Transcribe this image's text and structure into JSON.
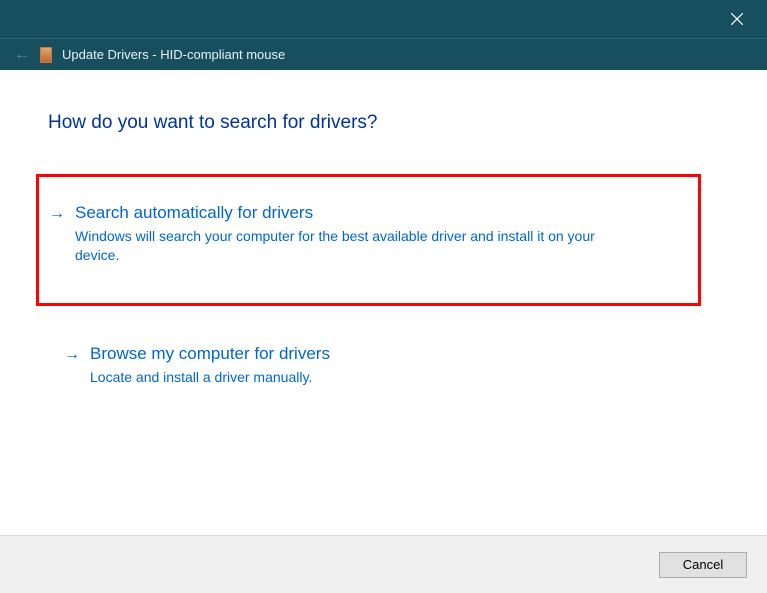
{
  "titlebar": {},
  "toolbar": {
    "title": "Update Drivers - HID-compliant mouse"
  },
  "content": {
    "heading": "How do you want to search for drivers?"
  },
  "options": [
    {
      "title": "Search automatically for drivers",
      "description": "Windows will search your computer for the best available driver and install it on your device."
    },
    {
      "title": "Browse my computer for drivers",
      "description": "Locate and install a driver manually."
    }
  ],
  "footer": {
    "cancel": "Cancel"
  }
}
